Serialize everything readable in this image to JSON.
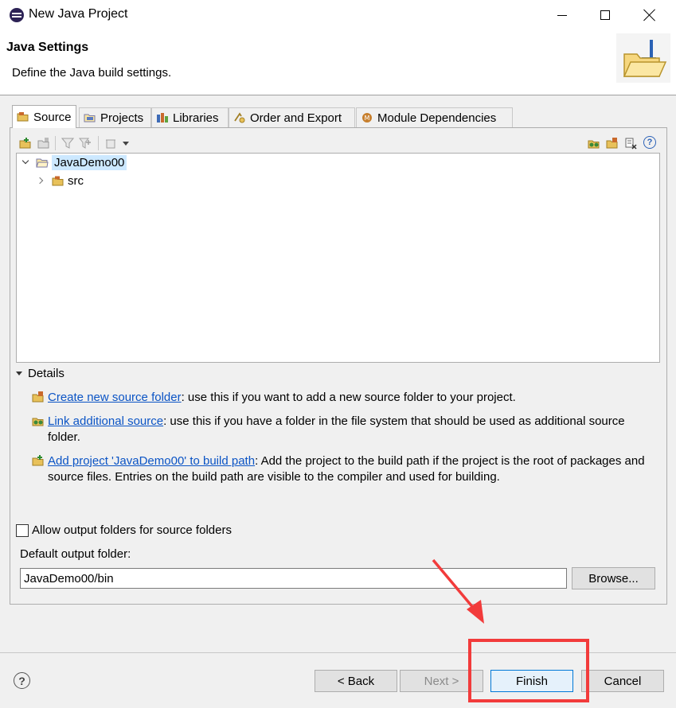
{
  "window": {
    "title": "New Java Project"
  },
  "header": {
    "title": "Java Settings",
    "description": "Define the Java build settings."
  },
  "tabs": [
    {
      "label": "Source",
      "active": true,
      "icon": "source-tab-icon"
    },
    {
      "label": "Projects",
      "active": false,
      "icon": "projects-tab-icon"
    },
    {
      "label": "Libraries",
      "active": false,
      "icon": "libraries-tab-icon"
    },
    {
      "label": "Order and Export",
      "active": false,
      "icon": "order-export-tab-icon"
    },
    {
      "label": "Module Dependencies",
      "active": false,
      "icon": "module-dependencies-tab-icon"
    }
  ],
  "tree": {
    "root": {
      "label": "JavaDemo00",
      "expanded": true,
      "selected": true
    },
    "children": [
      {
        "label": "src",
        "expanded": false
      }
    ]
  },
  "details": {
    "toggle_label": "Details",
    "items": [
      {
        "link": "Create new source folder",
        "text": ": use this if you want to add a new source folder to your project."
      },
      {
        "link": "Link additional source",
        "text": ": use this if you have a folder in the file system that should be used as additional source folder."
      },
      {
        "link": "Add project 'JavaDemo00' to build path",
        "text": ": Add the project to the build path if the project is the root of packages and source files. Entries on the build path are visible to the compiler and used for building."
      }
    ]
  },
  "output": {
    "allow_checkbox_label": "Allow output folders for source folders",
    "allow_checked": false,
    "default_folder_label": "Default output folder:",
    "default_folder_value": "JavaDemo00/bin",
    "browse_label": "Browse..."
  },
  "buttons": {
    "back": "< Back",
    "next": "Next >",
    "finish": "Finish",
    "cancel": "Cancel",
    "help": "?"
  },
  "colors": {
    "link": "#0b54c5",
    "selection": "#cce8ff",
    "annotation": "#f23b3b",
    "default_button_border": "#0078d7"
  }
}
